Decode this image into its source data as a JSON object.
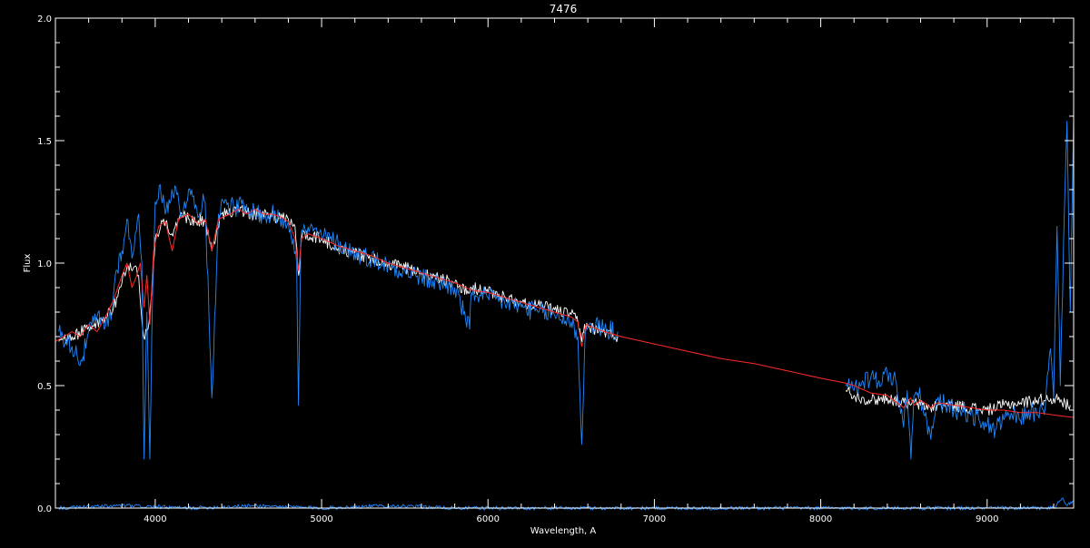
{
  "chart_data": {
    "type": "line",
    "title": "7476",
    "xlabel": "Wavelength, A",
    "ylabel": "Flux",
    "xlim": [
      3400,
      9520
    ],
    "ylim": [
      0.0,
      2.0
    ],
    "x_ticks": [
      4000,
      5000,
      6000,
      7000,
      8000,
      9000
    ],
    "y_ticks": [
      0.0,
      0.5,
      1.0,
      1.5,
      2.0
    ],
    "x_tick_labels": [
      "4000",
      "5000",
      "6000",
      "7000",
      "8000",
      "9000"
    ],
    "y_tick_labels": [
      "0.0",
      "0.5",
      "1.0",
      "1.5",
      "2.0"
    ],
    "grid": false,
    "background": "#000000",
    "series": [
      {
        "color": "#ffffff",
        "segments": [
          {
            "x": [
              3420,
              3500,
              3600,
              3700,
              3750,
              3800,
              3850,
              3900,
              3930,
              3950,
              3970,
              4000,
              4050,
              4100,
              4150,
              4200,
              4300,
              4340,
              4400,
              4500,
              4600,
              4700,
              4800,
              4840,
              4862,
              4880,
              4900,
              5000,
              5100,
              5200,
              5300,
              5400,
              5500,
              5600,
              5700,
              5800,
              5890,
              5900,
              6000,
              6100,
              6200,
              6300,
              6400,
              6500,
              6540,
              6563,
              6580,
              6600,
              6700,
              6780
            ],
            "y": [
              0.68,
              0.7,
              0.74,
              0.78,
              0.82,
              0.92,
              1.0,
              0.95,
              0.7,
              0.72,
              0.82,
              1.1,
              1.18,
              1.12,
              1.2,
              1.18,
              1.17,
              1.05,
              1.2,
              1.22,
              1.2,
              1.19,
              1.18,
              1.15,
              0.95,
              1.1,
              1.12,
              1.1,
              1.06,
              1.04,
              1.02,
              1.0,
              0.98,
              0.96,
              0.94,
              0.92,
              0.88,
              0.9,
              0.88,
              0.86,
              0.84,
              0.83,
              0.81,
              0.79,
              0.76,
              0.68,
              0.75,
              0.74,
              0.72,
              0.7
            ]
          },
          {
            "x": [
              8150,
              8200,
              8300,
              8400,
              8500,
              8540,
              8560,
              8600,
              8660,
              8700,
              8800,
              8900,
              9000,
              9100,
              9200,
              9300,
              9400,
              9450,
              9500
            ],
            "y": [
              0.48,
              0.46,
              0.44,
              0.45,
              0.43,
              0.42,
              0.43,
              0.42,
              0.41,
              0.42,
              0.42,
              0.41,
              0.4,
              0.42,
              0.43,
              0.44,
              0.45,
              0.43,
              0.42
            ]
          }
        ]
      },
      {
        "color": "#1e88ff",
        "segments": [
          {
            "x": [
              3420,
              3500,
              3560,
              3600,
              3650,
              3700,
              3740,
              3760,
              3800,
              3830,
              3860,
              3880,
              3900,
              3920,
              3933,
              3950,
              3968,
              3985,
              4000,
              4030,
              4060,
              4100,
              4130,
              4160,
              4200,
              4250,
              4300,
              4340,
              4380,
              4420,
              4480,
              4520,
              4560,
              4600,
              4650,
              4700,
              4750,
              4800,
              4830,
              4850,
              4861,
              4875,
              4900,
              4950,
              5000,
              5050,
              5100,
              5150,
              5200,
              5300,
              5400,
              5500,
              5600,
              5700,
              5800,
              5890,
              5900,
              5950,
              6000,
              6100,
              6200,
              6300,
              6400,
              6500,
              6540,
              6563,
              6585,
              6620,
              6700,
              6780
            ],
            "y": [
              0.72,
              0.66,
              0.6,
              0.72,
              0.78,
              0.74,
              0.8,
              0.95,
              1.05,
              1.18,
              1.02,
              1.12,
              1.2,
              1.0,
              0.2,
              0.8,
              0.2,
              0.9,
              1.25,
              1.32,
              1.2,
              1.3,
              1.28,
              1.2,
              1.3,
              1.22,
              1.25,
              0.45,
              1.2,
              1.26,
              1.22,
              1.24,
              1.2,
              1.22,
              1.18,
              1.2,
              1.18,
              1.17,
              1.1,
              1.0,
              0.42,
              1.1,
              1.14,
              1.13,
              1.11,
              1.1,
              1.08,
              1.06,
              1.04,
              1.02,
              0.99,
              0.97,
              0.94,
              0.92,
              0.9,
              0.73,
              0.88,
              0.87,
              0.86,
              0.84,
              0.82,
              0.8,
              0.79,
              0.76,
              0.7,
              0.26,
              0.72,
              0.75,
              0.73,
              0.72
            ]
          },
          {
            "x": [
              8150,
              8200,
              8250,
              8300,
              8350,
              8400,
              8450,
              8498,
              8520,
              8542,
              8560,
              8600,
              8662,
              8700,
              8750,
              8800,
              8850,
              8900,
              8950,
              9000,
              9050,
              9100,
              9150,
              9200,
              9250,
              9300,
              9350,
              9380,
              9400,
              9420,
              9440,
              9460,
              9480,
              9500,
              9520
            ],
            "y": [
              0.5,
              0.48,
              0.52,
              0.53,
              0.52,
              0.55,
              0.52,
              0.33,
              0.48,
              0.2,
              0.46,
              0.45,
              0.28,
              0.44,
              0.42,
              0.4,
              0.4,
              0.38,
              0.36,
              0.34,
              0.32,
              0.36,
              0.38,
              0.36,
              0.4,
              0.38,
              0.42,
              0.65,
              0.45,
              1.15,
              0.5,
              1.1,
              1.58,
              0.8,
              1.6
            ]
          },
          {
            "x": [
              3420,
              3800,
              4200,
              4600,
              5000,
              5400,
              5800,
              6200,
              6600,
              7000,
              8200,
              8600,
              9000,
              9400,
              9450,
              9480,
              9520
            ],
            "y": [
              0.0,
              0.01,
              0.0,
              0.01,
              0.0,
              0.01,
              0.0,
              0.0,
              0.0,
              0.0,
              0.0,
              0.0,
              0.0,
              0.0,
              0.04,
              0.01,
              0.03
            ]
          }
        ]
      },
      {
        "color": "#ff2a2a",
        "segments": [
          {
            "x": [
              3400,
              3450,
              3500,
              3550,
              3600,
              3650,
              3700,
              3750,
              3800,
              3830,
              3860,
              3889,
              3910,
              3933,
              3950,
              3968,
              3990,
              4020,
              4060,
              4102,
              4140,
              4200,
              4260,
              4300,
              4340,
              4380,
              4450,
              4500,
              4550,
              4600,
              4650,
              4700,
              4750,
              4800,
              4840,
              4861,
              4880,
              4920,
              5000,
              5100,
              5200,
              5300,
              5400,
              5500,
              5600,
              5700,
              5800,
              5900,
              6000,
              6100,
              6200,
              6300,
              6400,
              6500,
              6540,
              6563,
              6590,
              6620,
              6700,
              6800,
              7000,
              7200,
              7400,
              7600,
              7800,
              8000,
              8150,
              8200,
              8300,
              8400,
              8498,
              8540,
              8560,
              8600,
              8662,
              8700,
              8800,
              8900,
              9000,
              9100,
              9200,
              9300,
              9400,
              9520
            ],
            "y": [
              0.68,
              0.7,
              0.72,
              0.7,
              0.75,
              0.72,
              0.78,
              0.85,
              0.95,
              1.0,
              0.9,
              0.95,
              1.0,
              0.82,
              0.95,
              0.75,
              1.05,
              1.15,
              1.17,
              1.05,
              1.18,
              1.2,
              1.16,
              1.18,
              1.05,
              1.18,
              1.2,
              1.22,
              1.2,
              1.22,
              1.2,
              1.2,
              1.19,
              1.17,
              1.1,
              0.97,
              1.1,
              1.12,
              1.1,
              1.07,
              1.05,
              1.03,
              1.0,
              0.98,
              0.96,
              0.94,
              0.92,
              0.89,
              0.88,
              0.86,
              0.84,
              0.82,
              0.8,
              0.78,
              0.76,
              0.66,
              0.75,
              0.74,
              0.72,
              0.7,
              0.67,
              0.64,
              0.61,
              0.59,
              0.56,
              0.53,
              0.51,
              0.5,
              0.47,
              0.46,
              0.41,
              0.45,
              0.42,
              0.44,
              0.41,
              0.43,
              0.42,
              0.41,
              0.4,
              0.4,
              0.39,
              0.39,
              0.38,
              0.37
            ]
          }
        ]
      }
    ]
  }
}
